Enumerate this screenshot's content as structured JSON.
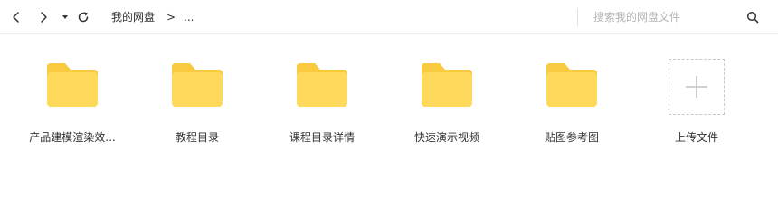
{
  "toolbar": {
    "back_icon": "chevron-left-icon",
    "forward_icon": "chevron-right-icon",
    "history_icon": "caret-down-icon",
    "refresh_icon": "refresh-icon",
    "breadcrumb": {
      "root": "我的网盘",
      "separator": ">",
      "more": "..."
    },
    "search": {
      "placeholder": "搜索我的网盘文件",
      "value": "",
      "icon": "search-icon"
    }
  },
  "items": [
    {
      "type": "folder",
      "name": "产品建模渲染效...",
      "icon": "folder-icon"
    },
    {
      "type": "folder",
      "name": "教程目录",
      "icon": "folder-icon"
    },
    {
      "type": "folder",
      "name": "课程目录详情",
      "icon": "folder-icon"
    },
    {
      "type": "folder",
      "name": "快速演示视频",
      "icon": "folder-icon"
    },
    {
      "type": "folder",
      "name": "贴图参考图",
      "icon": "folder-icon"
    },
    {
      "type": "upload",
      "name": "上传文件",
      "icon": "plus-icon"
    }
  ],
  "colors": {
    "folder_body": "#FFD95C",
    "folder_tab": "#F9C93F",
    "icon": "#333333",
    "muted": "#B4B4B4"
  }
}
